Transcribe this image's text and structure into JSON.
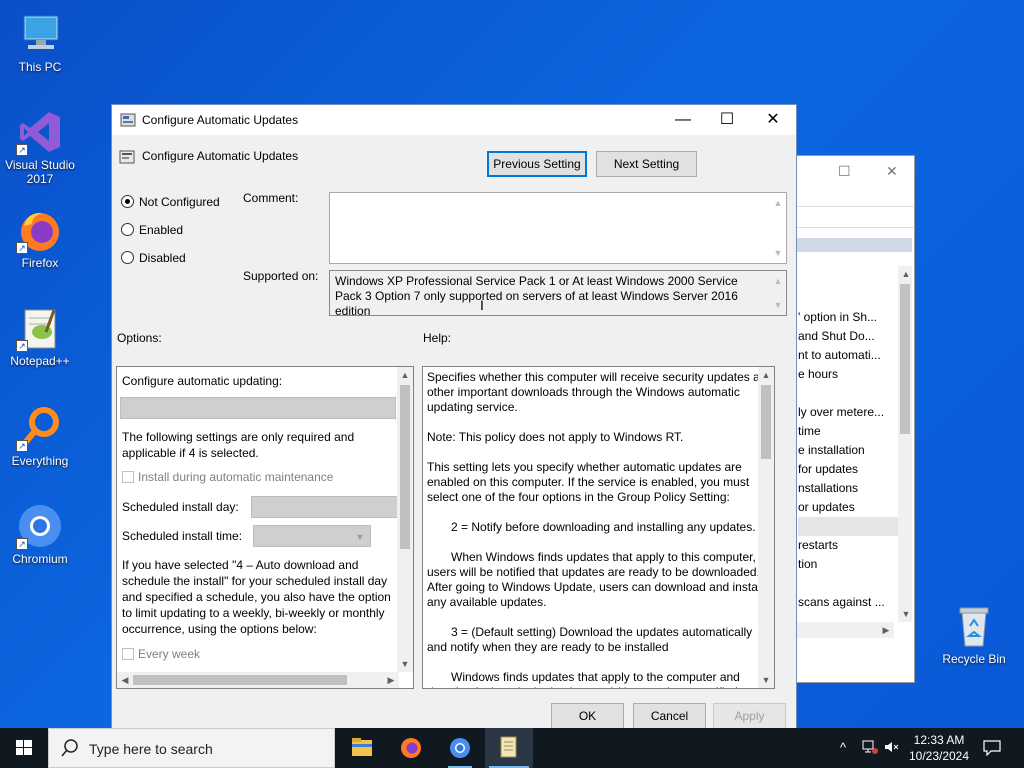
{
  "desktop": {
    "icons": [
      {
        "label": "This PC"
      },
      {
        "label": "Visual Studio 2017"
      },
      {
        "label": "Firefox"
      },
      {
        "label": "Notepad++"
      },
      {
        "label": "Everything"
      },
      {
        "label": "Chromium"
      },
      {
        "label": "Recycle Bin"
      }
    ]
  },
  "background_window": {
    "items": [
      "' option in Sh...",
      "and Shut Do...",
      "nt to automati...",
      "e hours",
      "",
      "ly over metere...",
      "time",
      "e installation",
      "for updates",
      "nstallations",
      "or updates",
      "",
      "restarts",
      "tion",
      "",
      "scans against ..."
    ]
  },
  "dialog": {
    "title": "Configure Automatic Updates",
    "header_title": "Configure Automatic Updates",
    "prev_button": "Previous Setting",
    "next_button": "Next Setting",
    "radio_not_configured": "Not Configured",
    "radio_enabled": "Enabled",
    "radio_disabled": "Disabled",
    "selected_state": "Not Configured",
    "comment_label": "Comment:",
    "comment_value": "",
    "supported_label": "Supported on:",
    "supported_text": "Windows XP Professional Service Pack 1 or At least Windows 2000 Service Pack 3 Option 7 only supported on servers of at least Windows Server 2016 edition",
    "options_label": "Options:",
    "help_label": "Help:",
    "options": {
      "configure_label": "Configure automatic updating:",
      "following_text": "The following settings are only required and applicable if 4 is selected.",
      "maintenance_checkbox": "Install during automatic maintenance",
      "install_day_label": "Scheduled install day:",
      "install_time_label": "Scheduled install time:",
      "if_selected_text": "If you have selected \"4 – Auto download and schedule the install\" for your scheduled install day and specified a schedule, you also have the option to limit updating to a weekly, bi-weekly or monthly occurrence, using the options below:",
      "every_week_checkbox": "Every week"
    },
    "help": {
      "p1": "Specifies whether this computer will receive security updates and other important downloads through the Windows automatic updating service.",
      "p2": "Note: This policy does not apply to Windows RT.",
      "p3": "This setting lets you specify whether automatic updates are enabled on this computer. If the service is enabled, you must select one of the four options in the Group Policy Setting:",
      "p4": "2 = Notify before downloading and installing any updates.",
      "p5": "When Windows finds updates that apply to this computer, users will be notified that updates are ready to be downloaded. After going to Windows Update, users can download and install any available updates.",
      "p6": "3 = (Default setting) Download the updates automatically and notify when they are ready to be installed",
      "p7": "Windows finds updates that apply to the computer and downloads them in the background (the user is not notified or"
    },
    "ok_button": "OK",
    "cancel_button": "Cancel",
    "apply_button": "Apply"
  },
  "taskbar": {
    "search_placeholder": "Type here to search",
    "time": "12:33 AM",
    "date": "10/23/2024"
  },
  "colors": {
    "desktop": "#0b5fd8",
    "taskbar": "#101820",
    "accent": "#0078d7"
  }
}
